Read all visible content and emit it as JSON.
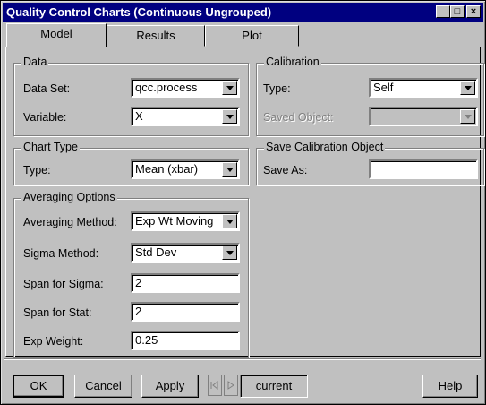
{
  "window": {
    "title": "Quality Control Charts (Continuous Ungrouped)"
  },
  "tabs": [
    {
      "label": "Model"
    },
    {
      "label": "Results"
    },
    {
      "label": "Plot"
    }
  ],
  "data_group": {
    "legend": "Data",
    "data_set_label": "Data Set:",
    "data_set_value": "qcc.process",
    "variable_label": "Variable:",
    "variable_value": "X"
  },
  "chart_type_group": {
    "legend": "Chart Type",
    "type_label": "Type:",
    "type_value": "Mean (xbar)"
  },
  "averaging_group": {
    "legend": "Averaging Options",
    "method_label": "Averaging Method:",
    "method_value": "Exp Wt Moving",
    "sigma_label": "Sigma Method:",
    "sigma_value": "Std Dev",
    "span_sigma_label": "Span for Sigma:",
    "span_sigma_value": "2",
    "span_stat_label": "Span for Stat:",
    "span_stat_value": "2",
    "exp_weight_label": "Exp Weight:",
    "exp_weight_value": "0.25"
  },
  "calibration_group": {
    "legend": "Calibration",
    "type_label": "Type:",
    "type_value": "Self",
    "saved_object_label": "Saved Object:",
    "saved_object_value": ""
  },
  "save_calibration_group": {
    "legend": "Save Calibration Object",
    "save_as_label": "Save As:",
    "save_as_value": ""
  },
  "buttons": {
    "ok": "OK",
    "cancel": "Cancel",
    "apply": "Apply",
    "current": "current",
    "help": "Help"
  },
  "colors": {
    "titlebar": "#000080",
    "face": "#c0c0c0"
  }
}
